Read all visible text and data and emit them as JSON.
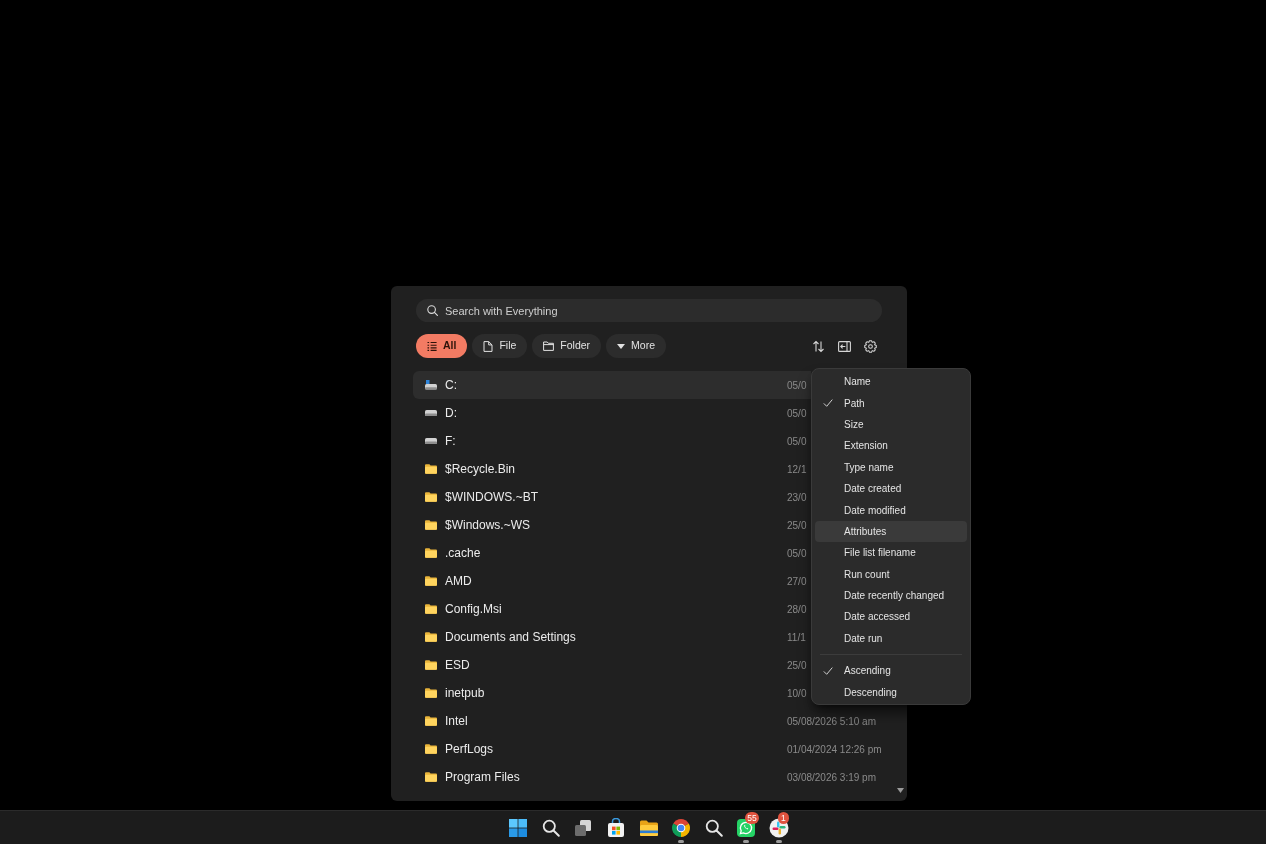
{
  "search": {
    "placeholder": "Search with Everything"
  },
  "filters": [
    {
      "label": "All",
      "kind": "list",
      "selected": true
    },
    {
      "label": "File",
      "kind": "file",
      "selected": false
    },
    {
      "label": "Folder",
      "kind": "folder",
      "selected": false
    },
    {
      "label": "More",
      "kind": "dropdown",
      "selected": false
    }
  ],
  "rows": [
    {
      "name": "C:",
      "kind": "system",
      "date": "05/0",
      "selected": true
    },
    {
      "name": "D:",
      "kind": "drive",
      "date": "05/0",
      "selected": false
    },
    {
      "name": "F:",
      "kind": "drive",
      "date": "05/0",
      "selected": false
    },
    {
      "name": "$Recycle.Bin",
      "kind": "folder",
      "date": "12/1",
      "selected": false
    },
    {
      "name": "$WINDOWS.~BT",
      "kind": "folder",
      "date": "23/0",
      "selected": false
    },
    {
      "name": "$Windows.~WS",
      "kind": "folder",
      "date": "25/0",
      "selected": false
    },
    {
      "name": ".cache",
      "kind": "folder",
      "date": "05/0",
      "selected": false
    },
    {
      "name": "AMD",
      "kind": "folder",
      "date": "27/0",
      "selected": false
    },
    {
      "name": "Config.Msi",
      "kind": "folder",
      "date": "28/0",
      "selected": false
    },
    {
      "name": "Documents and Settings",
      "kind": "folder",
      "date": "11/1",
      "selected": false
    },
    {
      "name": "ESD",
      "kind": "folder",
      "date": "25/0",
      "selected": false
    },
    {
      "name": "inetpub",
      "kind": "folder",
      "date": "10/0",
      "selected": false
    },
    {
      "name": "Intel",
      "kind": "folder",
      "date": "05/08/2026 5:10 am",
      "selected": false
    },
    {
      "name": "PerfLogs",
      "kind": "folder",
      "date": "01/04/2024 12:26 pm",
      "selected": false
    },
    {
      "name": "Program Files",
      "kind": "folder",
      "date": "03/08/2026 3:19 pm",
      "selected": false
    }
  ],
  "sort_menu": {
    "fields": [
      {
        "label": "Name",
        "checked": false,
        "highlighted": false
      },
      {
        "label": "Path",
        "checked": true,
        "highlighted": false
      },
      {
        "label": "Size",
        "checked": false,
        "highlighted": false
      },
      {
        "label": "Extension",
        "checked": false,
        "highlighted": false
      },
      {
        "label": "Type name",
        "checked": false,
        "highlighted": false
      },
      {
        "label": "Date created",
        "checked": false,
        "highlighted": false
      },
      {
        "label": "Date modified",
        "checked": false,
        "highlighted": false
      },
      {
        "label": "Attributes",
        "checked": false,
        "highlighted": true
      },
      {
        "label": "File list filename",
        "checked": false,
        "highlighted": false
      },
      {
        "label": "Run count",
        "checked": false,
        "highlighted": false
      },
      {
        "label": "Date recently changed",
        "checked": false,
        "highlighted": false
      },
      {
        "label": "Date accessed",
        "checked": false,
        "highlighted": false
      },
      {
        "label": "Date run",
        "checked": false,
        "highlighted": false
      }
    ],
    "order": [
      {
        "label": "Ascending",
        "checked": true,
        "highlighted": false
      },
      {
        "label": "Descending",
        "checked": false,
        "highlighted": false
      }
    ]
  },
  "taskbar": {
    "apps": [
      {
        "kind": "start",
        "running": false
      },
      {
        "kind": "search",
        "running": false
      },
      {
        "kind": "taskview",
        "running": false
      },
      {
        "kind": "store",
        "running": false
      },
      {
        "kind": "files",
        "running": false
      },
      {
        "kind": "browser",
        "running": true
      },
      {
        "kind": "search",
        "running": false
      },
      {
        "kind": "chat",
        "running": true,
        "badge": "55"
      },
      {
        "kind": "workspace",
        "running": true,
        "badge": "1"
      }
    ]
  }
}
